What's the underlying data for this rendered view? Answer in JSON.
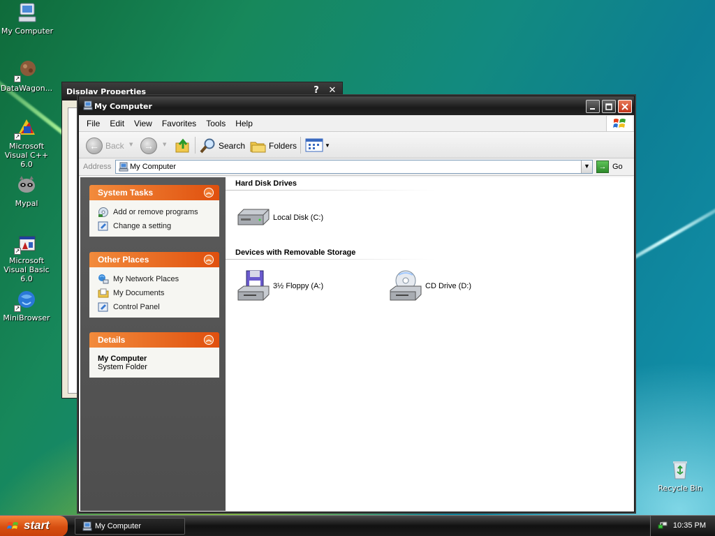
{
  "desktop": {
    "icons": [
      {
        "label": "My Computer"
      },
      {
        "label": "DataWagon..."
      },
      {
        "label": "Microsoft Visual C++ 6.0"
      },
      {
        "label": "Mypal"
      },
      {
        "label": "Microsoft Visual Basic 6.0"
      },
      {
        "label": "MiniBrowser"
      },
      {
        "label": "Recycle Bin"
      }
    ]
  },
  "back_window": {
    "title": "Display Properties",
    "help_glyph": "?",
    "close_glyph": "✕"
  },
  "window": {
    "title": "My Computer",
    "menu": [
      "File",
      "Edit",
      "View",
      "Favorites",
      "Tools",
      "Help"
    ],
    "toolbar": {
      "back_label": "Back",
      "search_label": "Search",
      "folders_label": "Folders"
    },
    "address": {
      "label": "Address",
      "value": "My Computer",
      "go_label": "Go"
    },
    "tasks_panels": [
      {
        "title": "System Tasks",
        "items": [
          "Add or remove programs",
          "Change a setting"
        ]
      },
      {
        "title": "Other Places",
        "items": [
          "My Network Places",
          "My Documents",
          "Control Panel"
        ]
      },
      {
        "title": "Details",
        "detail_title": "My Computer",
        "detail_sub": "System Folder"
      }
    ],
    "groups": [
      {
        "title": "Hard Disk Drives",
        "items": [
          "Local Disk (C:)"
        ]
      },
      {
        "title": "Devices with Removable Storage",
        "items": [
          "3½ Floppy (A:)",
          "CD Drive (D:)"
        ]
      }
    ]
  },
  "taskbar": {
    "start_label": "start",
    "task_label": "My Computer",
    "clock": "10:35 PM"
  },
  "colors": {
    "task_header": "#e0500e",
    "left_pane": "#525252",
    "titlebar": "#1a1a1a"
  }
}
